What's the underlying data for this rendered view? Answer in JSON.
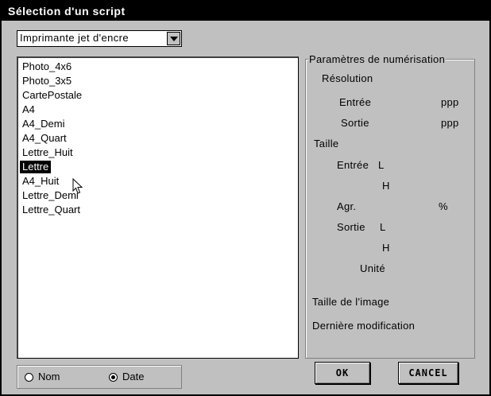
{
  "window": {
    "title": "Sélection d'un script"
  },
  "printer_select": {
    "value": "Imprimante jet d'encre"
  },
  "scripts": [
    "Photo_4x6",
    "Photo_3x5",
    "CartePostale",
    "A4",
    "A4_Demi",
    "A4_Quart",
    "Lettre_Huit",
    "Lettre",
    "A4_Huit",
    "Lettre_Demi",
    "Lettre_Quart"
  ],
  "selected_script": "Lettre",
  "scan_params": {
    "title": "Paramètres de numérisation",
    "resolution": "Résolution",
    "input": "Entrée",
    "output": "Sortie",
    "ppp": "ppp",
    "size": "Taille",
    "length": "L",
    "height": "H",
    "zoom": "Agr.",
    "percent": "%",
    "unit": "Unité",
    "image_size": "Taille de l'image",
    "last_modified": "Dernière modification"
  },
  "sort": {
    "name_label": "Nom",
    "date_label": "Date",
    "selected": "Date"
  },
  "buttons": {
    "ok": "OK",
    "cancel": "CANCEL"
  }
}
